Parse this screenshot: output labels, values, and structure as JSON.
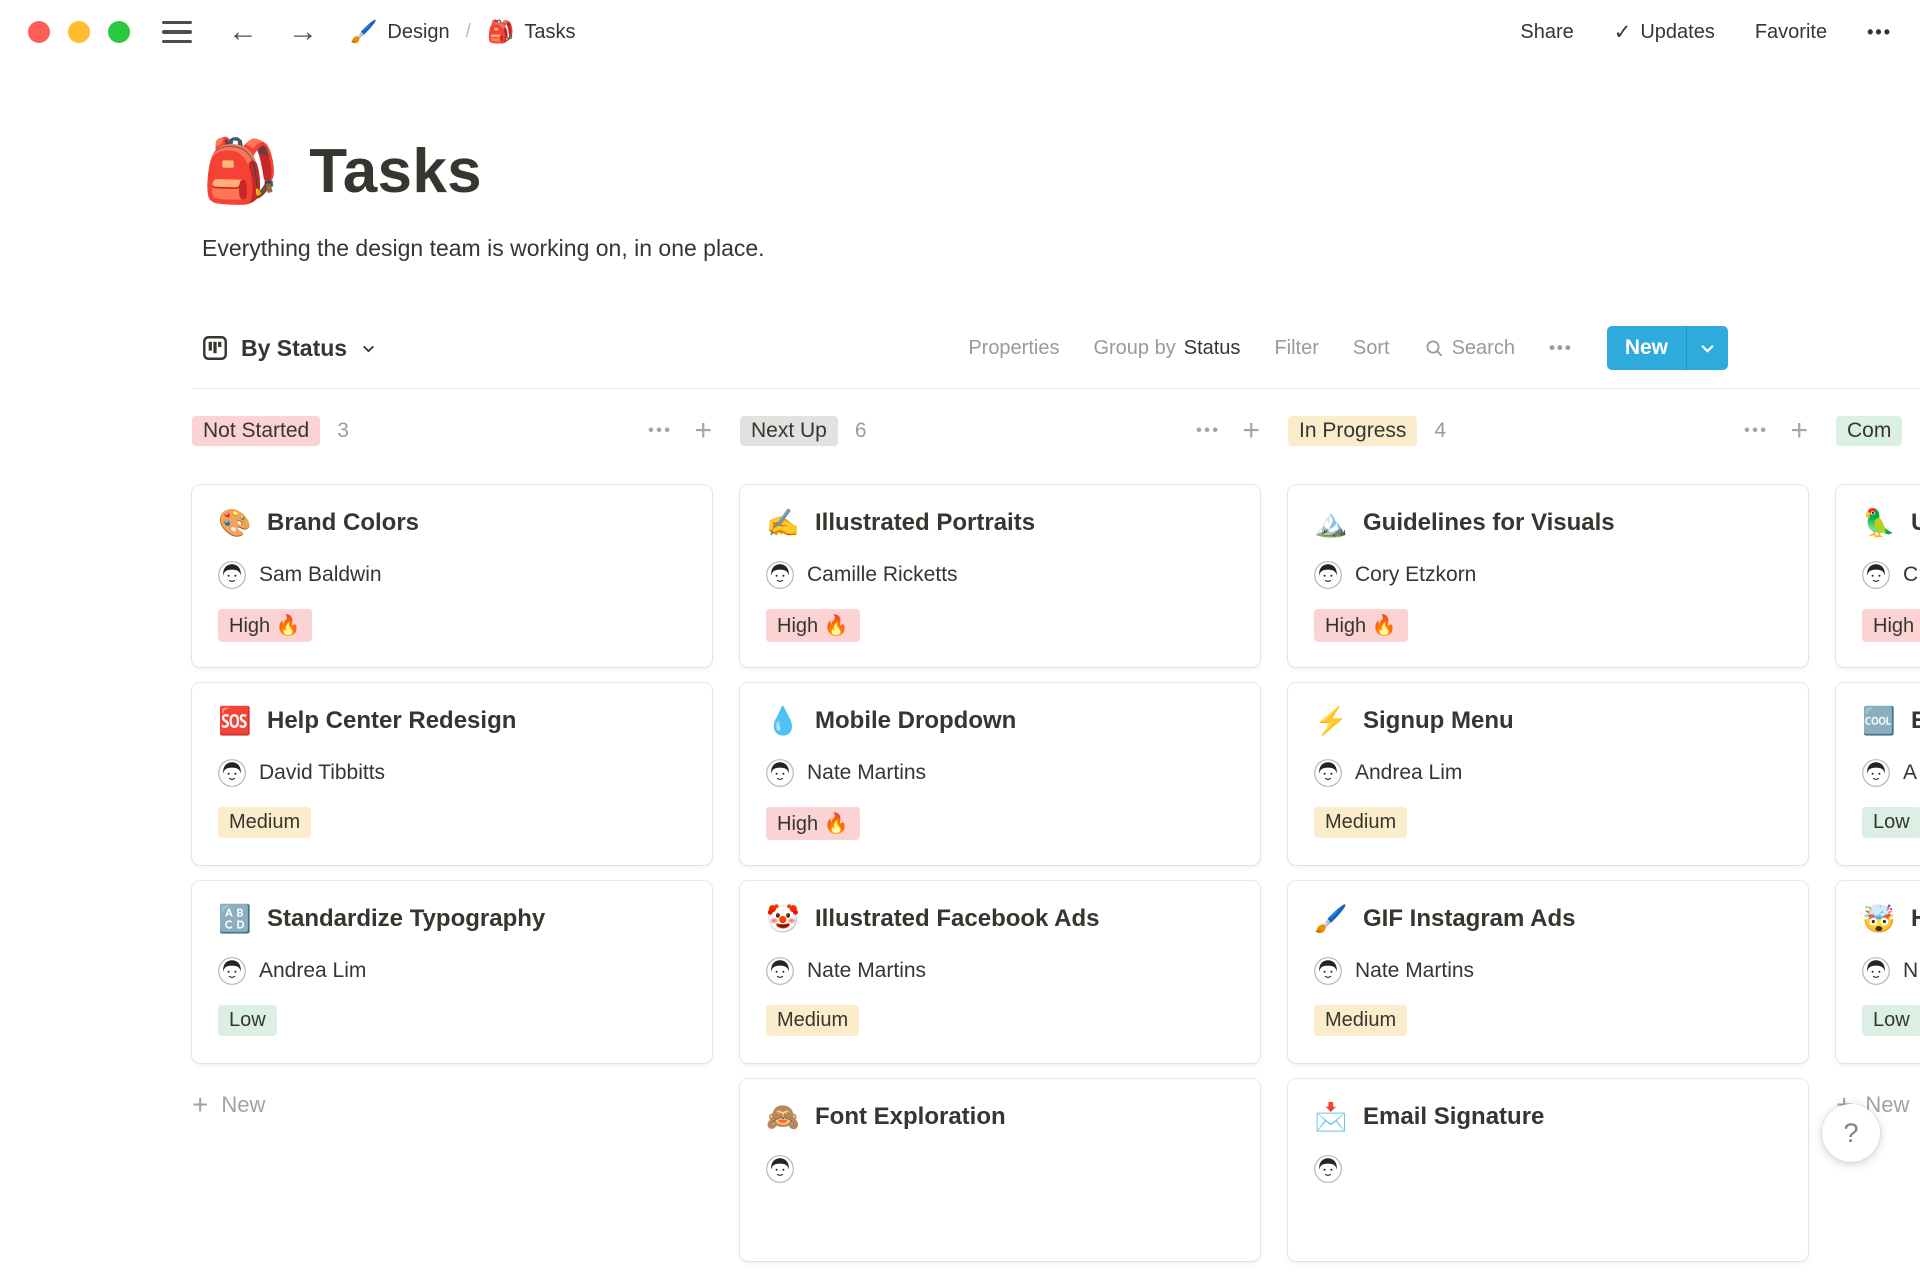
{
  "topbar": {
    "back_icon": "←",
    "forward_icon": "→",
    "breadcrumb": [
      {
        "icon": "🖌️",
        "label": "Design"
      },
      {
        "icon": "🎒",
        "label": "Tasks"
      }
    ],
    "separator": "/",
    "check_icon": "✓",
    "share_label": "Share",
    "updates_label": "Updates",
    "favorite_label": "Favorite",
    "more_icon": "•••"
  },
  "page": {
    "icon": "🎒",
    "title": "Tasks",
    "description": "Everything the design team is working on, in one place."
  },
  "toolbar": {
    "view_label": "By Status",
    "properties_label": "Properties",
    "group_by_label": "Group by",
    "group_by_value": "Status",
    "filter_label": "Filter",
    "sort_label": "Sort",
    "search_label": "Search",
    "more_icon": "•••",
    "new_label": "New"
  },
  "board": {
    "column_icons": {
      "more": "•••",
      "add": "+"
    },
    "footer_plus": "+",
    "columns": [
      {
        "label": "Not Started",
        "tone": "red",
        "count": "3",
        "footer": "New",
        "cards": [
          {
            "icon": "🎨",
            "title": "Brand Colors",
            "assignee": "Sam Baldwin",
            "priority": "High 🔥",
            "tone": "red"
          },
          {
            "icon": "🆘",
            "title": "Help Center Redesign",
            "assignee": "David Tibbitts",
            "priority": "Medium",
            "tone": "yellow"
          },
          {
            "icon": "🔠",
            "title": "Standardize Typography",
            "assignee": "Andrea Lim",
            "priority": "Low",
            "tone": "green"
          }
        ]
      },
      {
        "label": "Next Up",
        "tone": "gray",
        "count": "6",
        "cards": [
          {
            "icon": "✍️",
            "title": "Illustrated Portraits",
            "assignee": "Camille Ricketts",
            "priority": "High 🔥",
            "tone": "red"
          },
          {
            "icon": "💧",
            "title": "Mobile Dropdown",
            "assignee": "Nate Martins",
            "priority": "High 🔥",
            "tone": "red"
          },
          {
            "icon": "🤡",
            "title": "Illustrated Facebook Ads",
            "assignee": "Nate Martins",
            "priority": "Medium",
            "tone": "yellow"
          },
          {
            "icon": "🙈",
            "title": "Font Exploration",
            "assignee": ""
          }
        ]
      },
      {
        "label": "In Progress",
        "tone": "yellow",
        "count": "4",
        "cards": [
          {
            "icon": "🏔️",
            "title": "Guidelines for Visuals",
            "assignee": "Cory Etzkorn",
            "priority": "High 🔥",
            "tone": "red"
          },
          {
            "icon": "⚡",
            "title": "Signup Menu",
            "assignee": "Andrea Lim",
            "priority": "Medium",
            "tone": "yellow"
          },
          {
            "icon": "🖌️",
            "title": "GIF Instagram Ads",
            "assignee": "Nate Martins",
            "priority": "Medium",
            "tone": "yellow"
          },
          {
            "icon": "📩",
            "title": "Email Signature",
            "assignee": ""
          }
        ]
      },
      {
        "label": "Com",
        "tone": "green",
        "count": "",
        "footer": "New",
        "cards": [
          {
            "icon": "🦜",
            "title": "U",
            "assignee": "C",
            "priority": "High 🔥",
            "tone": "red"
          },
          {
            "icon": "🆒",
            "title": "E",
            "assignee": "A",
            "priority": "Low",
            "tone": "green"
          },
          {
            "icon": "🤯",
            "title": "H",
            "assignee": "N",
            "priority": "Low",
            "tone": "green"
          }
        ]
      }
    ]
  },
  "help": {
    "label": "?"
  },
  "colors": {
    "accent_blue": "#2EAADC",
    "badge_red_bg": "#FBD3D3",
    "badge_yellow_bg": "#FBEDCB",
    "badge_green_bg": "#DCEFE5",
    "badge_gray_bg": "#E3E2E0",
    "traffic_red": "#FF5F57",
    "traffic_yellow": "#FEBC2E",
    "traffic_green": "#28C840"
  }
}
